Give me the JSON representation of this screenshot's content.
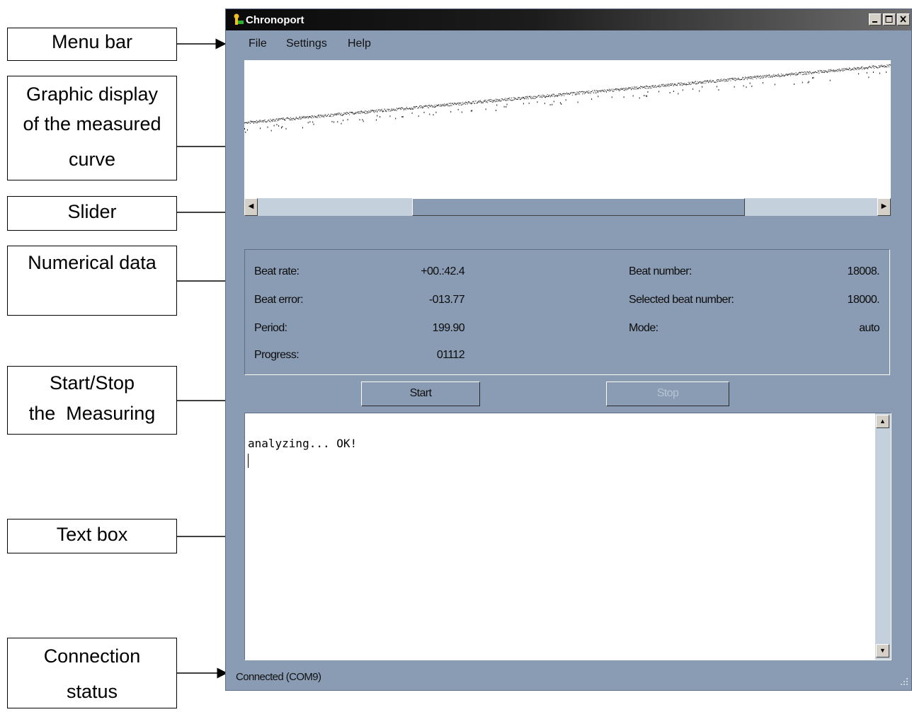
{
  "annotations": {
    "menu_bar": [
      "Menu bar"
    ],
    "graphic": [
      "Graphic display",
      "of the measured",
      "curve"
    ],
    "slider": [
      "Slider"
    ],
    "numerical": [
      "Numerical data"
    ],
    "startstop": [
      "Start/Stop",
      "the  Measuring"
    ],
    "textbox": [
      "Text box"
    ],
    "connection": [
      "Connection",
      "status"
    ]
  },
  "window": {
    "title": "Chronoport",
    "menu": [
      "File",
      "Settings",
      "Help"
    ]
  },
  "data": {
    "beat_rate_label": "Beat rate:",
    "beat_rate_value": "+00.:42.4",
    "beat_error_label": "Beat error:",
    "beat_error_value": "-013.77",
    "period_label": "Period:",
    "period_value": "199.90",
    "progress_label": "Progress:",
    "progress_value": "01112",
    "beat_number_label": "Beat number:",
    "beat_number_value": "18008.",
    "selected_beat_label": "Selected beat number:",
    "selected_beat_value": "18000.",
    "mode_label": "Mode:",
    "mode_value": "auto"
  },
  "buttons": {
    "start": "Start",
    "stop": "Stop"
  },
  "log": {
    "text": "analyzing... OK!"
  },
  "status": {
    "text": "Connected (COM9)"
  }
}
